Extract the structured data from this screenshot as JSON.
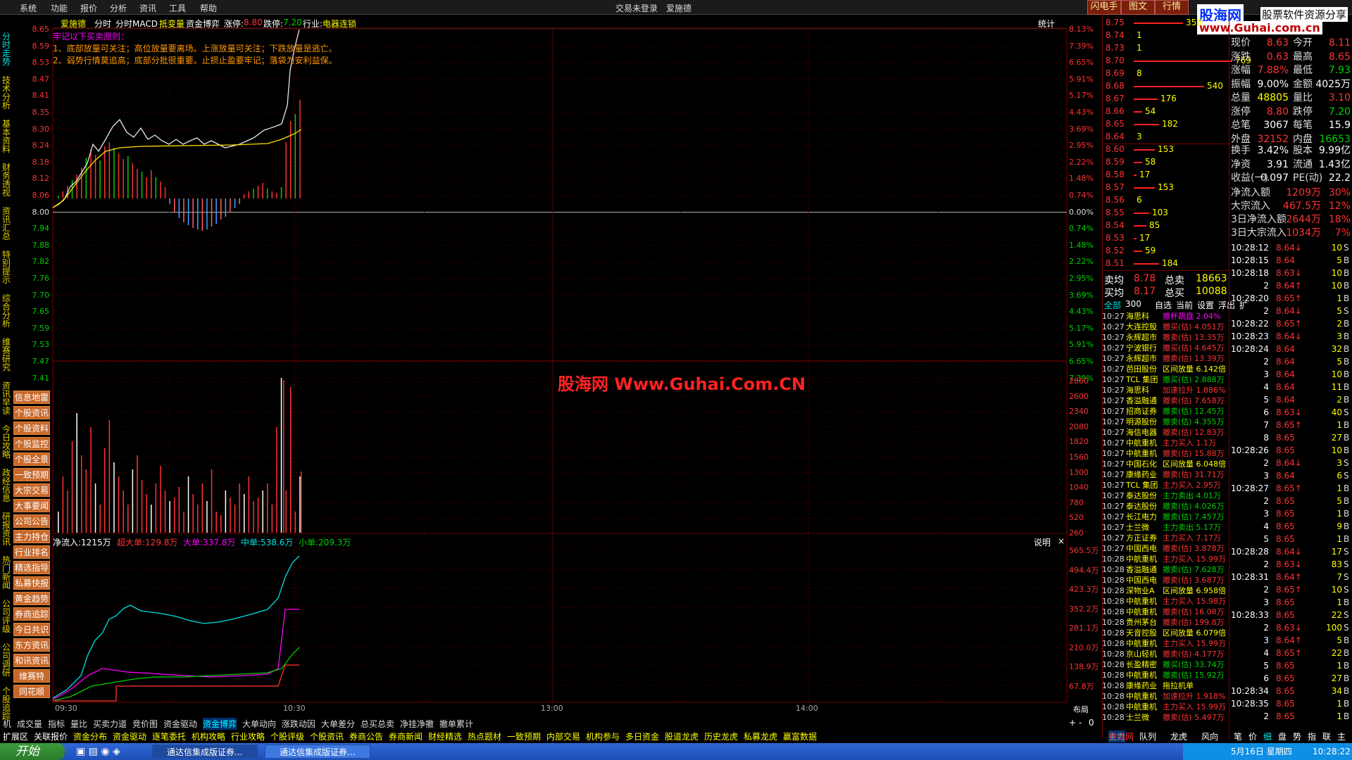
{
  "menu": {
    "items": [
      "系统",
      "功能",
      "报价",
      "分析",
      "资讯",
      "工具",
      "帮助"
    ],
    "center_title": "交易未登录　爱施德",
    "top_buttons": [
      "闪电手",
      "图文",
      "行情"
    ],
    "brand_name": "股海网",
    "brand_tagline": "股票软件资源分享",
    "brand_url": "www.Guhai.com.cn"
  },
  "left_tabs": [
    "分时走势",
    "技术分析",
    "基本资料",
    "财务透视",
    "资讯汇总",
    "特别提示",
    "综合分析",
    "维赛研究",
    "资讯早读",
    "今日攻略",
    "政经信息",
    "研报资讯",
    "热门新闻",
    "公司评级",
    "公司调研",
    "个股追踪"
  ],
  "left_buttons": [
    "信息地雷",
    "个股资讯",
    "个股资料",
    "个股监控",
    "个股全景",
    "一致预期",
    "大宗交易",
    "大事要闻",
    "公司公告",
    "主力持仓",
    "行业排名",
    "精选指导",
    "私募快报",
    "黄金趋势",
    "券商追踪",
    "今日共识",
    "东方资讯",
    "和讯资讯",
    "维赛特",
    "同花顺"
  ],
  "header": {
    "stock": "爱施德",
    "labels": [
      "分时",
      "分时MACD",
      "抵变量",
      "资金博弈"
    ],
    "limit_up_label": "涨停:",
    "limit_up": "8.80",
    "limit_down_label": "跌停:",
    "limit_down": "7.20",
    "industry_label": "行业:",
    "industry": "电器连锁",
    "stats_label": "统计"
  },
  "notes": {
    "title": "牢记以下买卖原则：",
    "lines": [
      "1、底部放量可关注；高位放量要离场。上涨放量可关注；下跌放量是逃亡。",
      "2、弱势行情莫追高；底部分批很重要。止损止盈要牢记；落袋为安利益保。"
    ]
  },
  "price_axis": {
    "left": [
      "8.65",
      "8.59",
      "8.53",
      "8.47",
      "8.41",
      "8.35",
      "8.30",
      "8.24",
      "8.18",
      "8.12",
      "8.06",
      "8.00",
      "7.94",
      "7.88",
      "7.82",
      "7.76",
      "7.70",
      "7.65",
      "7.59",
      "7.53",
      "7.47",
      "7.41"
    ],
    "right": [
      "8.13%",
      "7.39%",
      "6.65%",
      "5.91%",
      "5.17%",
      "4.43%",
      "3.69%",
      "2.95%",
      "2.22%",
      "1.48%",
      "0.74%",
      "0.00%",
      "0.74%",
      "1.48%",
      "2.22%",
      "2.95%",
      "3.69%",
      "4.43%",
      "5.17%",
      "5.91%",
      "6.65%",
      "7.39%"
    ]
  },
  "volume_axis": [
    "2860",
    "2600",
    "2340",
    "2080",
    "1820",
    "1560",
    "1300",
    "1040",
    "780",
    "520",
    "260"
  ],
  "watermark": "股海网 Www.Guhai.Com.CN",
  "flow": {
    "net_label": "净流入:1215万",
    "super": "超大单:129.8万",
    "big": "大单:337.8万",
    "mid": "中单:538.6万",
    "small": "小单:209.3万",
    "explain": "说明",
    "close": "×",
    "axis": [
      "565.5万",
      "494.4万",
      "423.3万",
      "352.2万",
      "281.1万",
      "210.0万",
      "138.9万",
      "67.8万"
    ]
  },
  "time_axis": [
    "09:30",
    "10:30",
    "13:00",
    "14:00"
  ],
  "layout_label": "布局",
  "bottom_tabs1": [
    "机",
    "成交量",
    "指标",
    "量比",
    "买卖力道",
    "竞价图",
    "资金驱动",
    "资金博弈",
    "大单动向",
    "涨跌动因",
    "大单差分",
    "总买总卖",
    "净挂净撤",
    "撤单累计"
  ],
  "bottom_tabs2": [
    "扩展区",
    "关联报价",
    "资金分布",
    "资金驱动",
    "逐笔委托",
    "机构攻略",
    "行业攻略",
    "个股评级",
    "个股资讯",
    "券商公告",
    "券商新闻",
    "财经精选",
    "热点题材",
    "一致预期",
    "内部交易",
    "机构参与",
    "多日资金",
    "股道龙虎",
    "历史龙虎",
    "私募龙虎",
    "赢富数据"
  ],
  "orderbook": {
    "sells": [
      {
        "p": "8.75",
        "v": "358",
        "w": 70
      },
      {
        "p": "8.74",
        "v": "1",
        "w": 0
      },
      {
        "p": "8.73",
        "v": "1",
        "w": 0
      },
      {
        "p": "8.70",
        "v": "769",
        "w": 140
      },
      {
        "p": "8.69",
        "v": "8",
        "w": 0
      },
      {
        "p": "8.68",
        "v": "540",
        "w": 100
      },
      {
        "p": "8.67",
        "v": "176",
        "w": 34
      },
      {
        "p": "8.66",
        "v": "54",
        "w": 12
      },
      {
        "p": "8.65",
        "v": "182",
        "w": 36
      },
      {
        "p": "8.64",
        "v": "3",
        "w": 0
      }
    ],
    "buys": [
      {
        "p": "8.60",
        "v": "153",
        "w": 30
      },
      {
        "p": "8.59",
        "v": "58",
        "w": 12
      },
      {
        "p": "8.58",
        "v": "17",
        "w": 4
      },
      {
        "p": "8.57",
        "v": "153",
        "w": 30
      },
      {
        "p": "8.56",
        "v": "6",
        "w": 0
      },
      {
        "p": "8.55",
        "v": "103",
        "w": 22
      },
      {
        "p": "8.54",
        "v": "85",
        "w": 18
      },
      {
        "p": "8.53",
        "v": "17",
        "w": 4
      },
      {
        "p": "8.52",
        "v": "59",
        "w": 12
      },
      {
        "p": "8.51",
        "v": "184",
        "w": 36
      }
    ],
    "avg_sell_label": "卖均",
    "avg_sell": "8.78",
    "total_sell_label": "总卖",
    "total_sell": "18663",
    "avg_buy_label": "买均",
    "avg_buy": "8.17",
    "total_buy_label": "总买",
    "total_buy": "10088"
  },
  "quote": [
    [
      {
        "k": "现价",
        "v": "8.63",
        "c": "red"
      },
      {
        "k": "今开",
        "v": "8.11",
        "c": "red"
      }
    ],
    [
      {
        "k": "涨跌",
        "v": "0.63",
        "c": "red"
      },
      {
        "k": "最高",
        "v": "8.65",
        "c": "red"
      }
    ],
    [
      {
        "k": "涨幅",
        "v": "7.88%",
        "c": "red"
      },
      {
        "k": "最低",
        "v": "7.93",
        "c": "grn"
      }
    ],
    [
      {
        "k": "振幅",
        "v": "9.00%",
        "c": "wht"
      },
      {
        "k": "金额",
        "v": "4025万",
        "c": "wht"
      }
    ],
    [
      {
        "k": "总量",
        "v": "48805",
        "c": "yel"
      },
      {
        "k": "量比",
        "v": "3.10",
        "c": "red"
      }
    ],
    [
      {
        "k": "涨停",
        "v": "8.80",
        "c": "red"
      },
      {
        "k": "跌停",
        "v": "7.20",
        "c": "grn"
      }
    ],
    [
      {
        "k": "总笔",
        "v": "3067",
        "c": "wht"
      },
      {
        "k": "每笔",
        "v": "15.9",
        "c": "wht"
      }
    ],
    [
      {
        "k": "外盘",
        "v": "32152",
        "c": "red"
      },
      {
        "k": "内盘",
        "v": "16653",
        "c": "grn"
      }
    ],
    [
      {
        "k": "换手",
        "v": "3.42%",
        "c": "wht"
      },
      {
        "k": "股本",
        "v": "9.99亿",
        "c": "wht"
      }
    ],
    [
      {
        "k": "净资",
        "v": "3.91",
        "c": "wht"
      },
      {
        "k": "流通",
        "v": "1.43亿",
        "c": "wht"
      }
    ],
    [
      {
        "k": "收益(一)",
        "v": "0.097",
        "c": "wht"
      },
      {
        "k": "PE(动)",
        "v": "22.2",
        "c": "wht"
      }
    ]
  ],
  "flow_stats": [
    {
      "k": "净流入额",
      "v": "1209万",
      "p": "30%"
    },
    {
      "k": "大宗流入",
      "v": "467.5万",
      "p": "12%"
    },
    {
      "k": "3日净流入额",
      "v": "2644万",
      "p": "18%"
    },
    {
      "k": "3日大宗流入",
      "v": "1034万",
      "p": "7%"
    }
  ],
  "ticks": [
    {
      "t": "10:28:12",
      "p": "8.64",
      "a": "↓",
      "v": "10",
      "s": "S",
      "c": "red"
    },
    {
      "t": "10:28:15",
      "p": "8.64",
      "a": "",
      "v": "5",
      "s": "B",
      "c": "red"
    },
    {
      "t": "10:28:18",
      "p": "8.63",
      "a": "↓",
      "v": "10",
      "s": "B",
      "c": "red"
    },
    {
      "t": "2",
      "p": "8.64",
      "a": "↑",
      "v": "10",
      "s": "B",
      "c": "red"
    },
    {
      "t": "10:28:20",
      "p": "8.65",
      "a": "↑",
      "v": "1",
      "s": "B",
      "c": "red"
    },
    {
      "t": "2",
      "p": "8.64",
      "a": "↓",
      "v": "5",
      "s": "S",
      "c": "red"
    },
    {
      "t": "10:28:22",
      "p": "8.65",
      "a": "↑",
      "v": "2",
      "s": "B",
      "c": "red"
    },
    {
      "t": "10:28:23",
      "p": "8.64",
      "a": "↓",
      "v": "3",
      "s": "B",
      "c": "red"
    },
    {
      "t": "10:28:24",
      "p": "8.64",
      "a": "",
      "v": "32",
      "s": "B",
      "c": "red"
    },
    {
      "t": "2",
      "p": "8.64",
      "a": "",
      "v": "5",
      "s": "B",
      "c": "red"
    },
    {
      "t": "3",
      "p": "8.64",
      "a": "",
      "v": "10",
      "s": "B",
      "c": "red"
    },
    {
      "t": "4",
      "p": "8.64",
      "a": "",
      "v": "11",
      "s": "B",
      "c": "red"
    },
    {
      "t": "5",
      "p": "8.64",
      "a": "",
      "v": "2",
      "s": "B",
      "c": "red"
    },
    {
      "t": "6",
      "p": "8.63",
      "a": "↓",
      "v": "40",
      "s": "S",
      "c": "red"
    },
    {
      "t": "7",
      "p": "8.65",
      "a": "↑",
      "v": "1",
      "s": "B",
      "c": "red"
    },
    {
      "t": "8",
      "p": "8.65",
      "a": "",
      "v": "27",
      "s": "B",
      "c": "red"
    },
    {
      "t": "10:28:26",
      "p": "8.65",
      "a": "",
      "v": "10",
      "s": "B",
      "c": "red"
    },
    {
      "t": "2",
      "p": "8.64",
      "a": "↓",
      "v": "3",
      "s": "S",
      "c": "red"
    },
    {
      "t": "3",
      "p": "8.64",
      "a": "",
      "v": "6",
      "s": "S",
      "c": "red"
    },
    {
      "t": "10:28:27",
      "p": "8.65",
      "a": "↑",
      "v": "1",
      "s": "B",
      "c": "red"
    },
    {
      "t": "2",
      "p": "8.65",
      "a": "",
      "v": "5",
      "s": "B",
      "c": "red"
    },
    {
      "t": "3",
      "p": "8.65",
      "a": "",
      "v": "1",
      "s": "B",
      "c": "red"
    },
    {
      "t": "4",
      "p": "8.65",
      "a": "",
      "v": "9",
      "s": "B",
      "c": "red"
    },
    {
      "t": "5",
      "p": "8.65",
      "a": "",
      "v": "1",
      "s": "B",
      "c": "red"
    },
    {
      "t": "10:28:28",
      "p": "8.64",
      "a": "↓",
      "v": "17",
      "s": "S",
      "c": "red"
    },
    {
      "t": "2",
      "p": "8.63",
      "a": "↓",
      "v": "83",
      "s": "S",
      "c": "red"
    },
    {
      "t": "10:28:31",
      "p": "8.64",
      "a": "↑",
      "v": "7",
      "s": "S",
      "c": "red"
    },
    {
      "t": "2",
      "p": "8.65",
      "a": "↑",
      "v": "10",
      "s": "S",
      "c": "red"
    },
    {
      "t": "3",
      "p": "8.65",
      "a": "",
      "v": "1",
      "s": "B",
      "c": "red"
    },
    {
      "t": "10:28:33",
      "p": "8.65",
      "a": "",
      "v": "22",
      "s": "S",
      "c": "red"
    },
    {
      "t": "2",
      "p": "8.63",
      "a": "↓",
      "v": "100",
      "s": "S",
      "c": "red"
    },
    {
      "t": "3",
      "p": "8.64",
      "a": "↑",
      "v": "5",
      "s": "B",
      "c": "red"
    },
    {
      "t": "4",
      "p": "8.65",
      "a": "↑",
      "v": "22",
      "s": "B",
      "c": "red"
    },
    {
      "t": "5",
      "p": "8.65",
      "a": "",
      "v": "1",
      "s": "B",
      "c": "red"
    },
    {
      "t": "6",
      "p": "8.65",
      "a": "",
      "v": "27",
      "s": "B",
      "c": "red"
    },
    {
      "t": "10:28:34",
      "p": "8.65",
      "a": "",
      "v": "34",
      "s": "B",
      "c": "red"
    },
    {
      "t": "10:28:35",
      "p": "8.65",
      "a": "",
      "v": "1",
      "s": "B",
      "c": "red"
    },
    {
      "t": "2",
      "p": "8.65",
      "a": "",
      "v": "1",
      "s": "B",
      "c": "red"
    }
  ],
  "radar_tabs": [
    "全部",
    "300",
    "自选",
    "当前",
    "设置",
    "浮出",
    "扩"
  ],
  "radar": [
    {
      "t": "10:27",
      "n": "海思科",
      "e": "撤杯跳盘 2.04%",
      "c": "mag"
    },
    {
      "t": "10:27",
      "n": "大连控股",
      "e": "撤买(估) 4.051万",
      "c": "red"
    },
    {
      "t": "10:27",
      "n": "永辉超市",
      "e": "撤卖(估) 13.35万",
      "c": "red"
    },
    {
      "t": "10:27",
      "n": "宁波银行",
      "e": "撤买(估) 4.645万",
      "c": "red"
    },
    {
      "t": "10:27",
      "n": "永辉超市",
      "e": "撤卖(估) 13.39万",
      "c": "red"
    },
    {
      "t": "10:27",
      "n": "芭田股份",
      "e": "区间放量 6.142倍",
      "c": "yel"
    },
    {
      "t": "10:27",
      "n": "TCL 集团",
      "e": "撤买(估) 2.888万",
      "c": "grn"
    },
    {
      "t": "10:27",
      "n": "海思科",
      "e": "加速拉升 1.886%",
      "c": "red"
    },
    {
      "t": "10:27",
      "n": "香溢融通",
      "e": "撤卖(估) 7.658万",
      "c": "red"
    },
    {
      "t": "10:27",
      "n": "招商证券",
      "e": "撤卖(估) 12.45万",
      "c": "grn"
    },
    {
      "t": "10:27",
      "n": "明源股份",
      "e": "撤卖(估) 4.355万",
      "c": "grn"
    },
    {
      "t": "10:27",
      "n": "海信电器",
      "e": "撤卖(估) 12.83万",
      "c": "red"
    },
    {
      "t": "10:27",
      "n": "中航重机",
      "e": "主力买入 1.1万",
      "c": "red"
    },
    {
      "t": "10:27",
      "n": "中航重机",
      "e": "撤卖(估) 15.88万",
      "c": "red"
    },
    {
      "t": "10:27",
      "n": "中国石化",
      "e": "区间放量 6.048倍",
      "c": "yel"
    },
    {
      "t": "10:27",
      "n": "康缘药业",
      "e": "撤卖(估) 31.71万",
      "c": "red"
    },
    {
      "t": "10:27",
      "n": "TCL 集团",
      "e": "主力买入 2.95万",
      "c": "red"
    },
    {
      "t": "10:27",
      "n": "泰达股份",
      "e": "主力卖出 4.01万",
      "c": "grn"
    },
    {
      "t": "10:27",
      "n": "泰达股份",
      "e": "撤卖(估) 4.026万",
      "c": "grn"
    },
    {
      "t": "10:27",
      "n": "长江电力",
      "e": "撤卖(估) 7.457万",
      "c": "grn"
    },
    {
      "t": "10:27",
      "n": "士兰微",
      "e": "主力卖出 5.17万",
      "c": "grn"
    },
    {
      "t": "10:27",
      "n": "方正证券",
      "e": "主力买入 7.17万",
      "c": "red"
    },
    {
      "t": "10:27",
      "n": "中国西电",
      "e": "撤卖(估) 3.878万",
      "c": "red"
    },
    {
      "t": "10:28",
      "n": "中航重机",
      "e": "主力买入 15.99万",
      "c": "red"
    },
    {
      "t": "10:28",
      "n": "香溢融通",
      "e": "撤卖(估) 7.628万",
      "c": "grn"
    },
    {
      "t": "10:28",
      "n": "中国西电",
      "e": "撤卖(估) 3.687万",
      "c": "red"
    },
    {
      "t": "10:28",
      "n": "深物业A",
      "e": "区间放量 6.958倍",
      "c": "yel"
    },
    {
      "t": "10:28",
      "n": "中航重机",
      "e": "主力买入 15.98万",
      "c": "red"
    },
    {
      "t": "10:28",
      "n": "中航重机",
      "e": "撤卖(估) 16.08万",
      "c": "red"
    },
    {
      "t": "10:28",
      "n": "贵州茅台",
      "e": "撤卖(估) 199.8万",
      "c": "red"
    },
    {
      "t": "10:28",
      "n": "天音控股",
      "e": "区间放量 6.079倍",
      "c": "yel"
    },
    {
      "t": "10:28",
      "n": "中航重机",
      "e": "主力买入 15.99万",
      "c": "red"
    },
    {
      "t": "10:28",
      "n": "京山轻机",
      "e": "撤卖(估) 4.177万",
      "c": "red"
    },
    {
      "t": "10:28",
      "n": "长盈精密",
      "e": "撤买(估) 33.74万",
      "c": "grn"
    },
    {
      "t": "10:28",
      "n": "中航重机",
      "e": "撤卖(估) 15.92万",
      "c": "grn"
    },
    {
      "t": "10:28",
      "n": "康缘药业",
      "e": "拖拉机单",
      "c": "yel"
    },
    {
      "t": "10:28",
      "n": "中航重机",
      "e": "加速拉升 1.918%",
      "c": "red"
    },
    {
      "t": "10:28",
      "n": "中航重机",
      "e": "主力买入 15.99万",
      "c": "red"
    },
    {
      "t": "10:28",
      "n": "士兰微",
      "e": "撤卖(估) 5.497万",
      "c": "red"
    }
  ],
  "panel_bottom_tabs": [
    "主力",
    "队列",
    "龙虎",
    "风向"
  ],
  "mini_tabs": [
    "笔",
    "价",
    "细",
    "盘",
    "势",
    "指",
    "联",
    "主"
  ],
  "pager": [
    "+",
    "-",
    "0"
  ],
  "radar_footer": "券商网",
  "taskbar": {
    "start": "开始",
    "tasks": [
      "通达信集成版证券...",
      "通达信集成版证券..."
    ],
    "date": "5月16日 星期四",
    "time": "10:28:22"
  }
}
